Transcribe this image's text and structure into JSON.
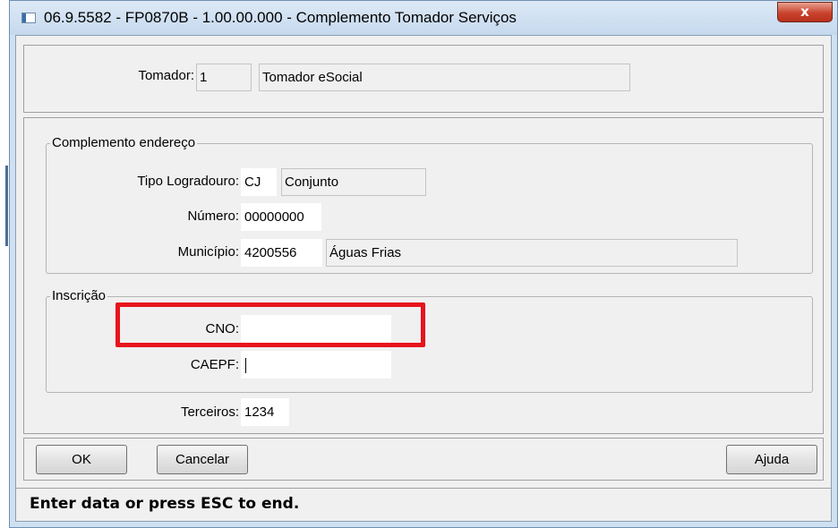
{
  "window": {
    "title": "06.9.5582 - FP0870B - 1.00.00.000 - Complemento Tomador Serviços",
    "close_symbol": "x"
  },
  "tomador": {
    "label": "Tomador:",
    "code": "1",
    "name": "Tomador eSocial"
  },
  "complemento": {
    "group_title": "Complemento endereço",
    "tipo_logradouro": {
      "label": "Tipo Logradouro:",
      "code": "CJ",
      "description": "Conjunto"
    },
    "numero": {
      "label": "Número:",
      "value": "00000000"
    },
    "municipio": {
      "label": "Município:",
      "code": "4200556",
      "name": "Águas Frias"
    }
  },
  "inscricao": {
    "group_title": "Inscrição",
    "cno": {
      "label": "CNO:",
      "value": ""
    },
    "caepf": {
      "label": "CAEPF:",
      "value": ""
    }
  },
  "terceiros": {
    "label": "Terceiros:",
    "value": "1234"
  },
  "buttons": {
    "ok": "OK",
    "cancel": "Cancelar",
    "help": "Ajuda"
  },
  "status_bar": {
    "text": "Enter data or press ESC to end."
  },
  "colors": {
    "highlight": "#e8141c",
    "close_button": "#c9432e",
    "title_bar": "#cfe0f1"
  }
}
